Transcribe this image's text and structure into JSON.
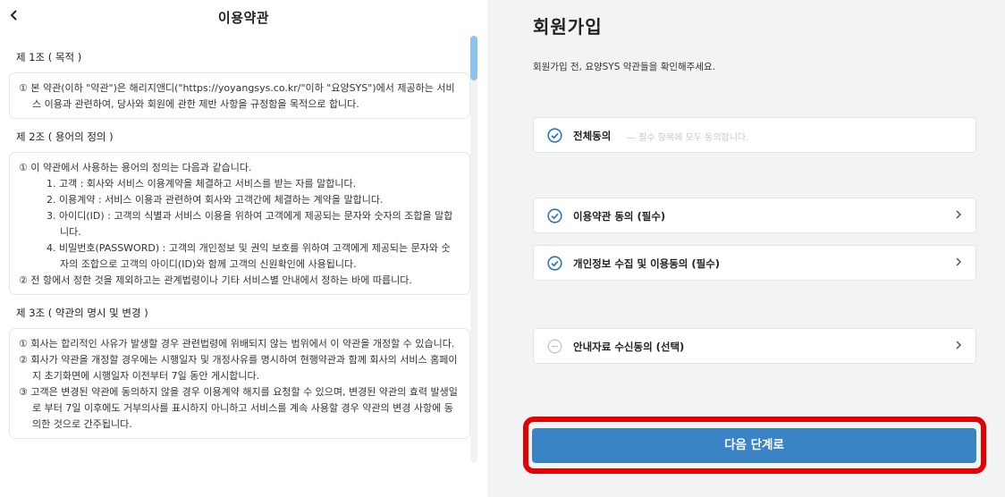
{
  "left_panel": {
    "title": "이용약관",
    "back_icon": "chevron-left-icon",
    "articles": [
      {
        "title": "제 1조 ( 목적 )",
        "paragraphs": [
          "① 본 약관(이하 \"약관\")은 해리지앤디(\"https://yoyangsys.co.kr/\"이하 \"요양SYS\")에서 제공하는 서비스 이용과 관련하여, 당사와 회원에 관한 제반 사항을 규정함을 목적으로 합니다."
        ]
      },
      {
        "title": "제 2조 ( 용어의 정의 )",
        "intro": "① 이 약관에서 사용하는 용어의 정의는 다음과 같습니다.",
        "items": [
          "1.  고객 : 회사와 서비스 이용계약을 체결하고 서비스를 받는 자를 말합니다.",
          "2.  이용계약 : 서비스 이용과 관련하여 회사와 고객간에 체결하는 계약을 말합니다.",
          "3.  아이디(ID) : 고객의 식별과 서비스 이용을 위하여 고객에게 제공되는 문자와 숫자의 조합을 말합니다.",
          "4.  비밀번호(PASSWORD) : 고객의 개인정보 및 권익 보호를 위하여 고객에게 제공되는 문자와 숫자의 조합으로 고객의 아이디(ID)와 함께 고객의 신원확인에 사용됩니다."
        ],
        "outro": "② 전 항에서 정한 것을 제외하고는 관계법령이나 기타 서비스별 안내에서 정하는 바에 따릅니다."
      },
      {
        "title": "제 3조 ( 약관의 명시 및 변경 )",
        "paragraphs": [
          "① 회사는 합리적인 사유가 발생할 경우 관련법령에 위배되지 않는 범위에서 이 약관을 개정할 수 있습니다.",
          "② 회사가 약관을 개정할 경우에는 시행일자 및 개정사유를 명시하여 현행약관과 함께 회사의 서비스 홈페이지 초기화면에 시행일자 이전부터 7일 동안 게시합니다.",
          "③ 고객은 변경된 약관에 동의하지 않을 경우 이용계약 해지를 요청할 수 있으며, 변경된 약관의 효력 발생일로 부터 7일 이후에도 거부의사를 표시하지 아니하고 서비스를 계속 사용할 경우 약관의 변경 사항에 동의한 것으로 간주됩니다."
        ]
      }
    ]
  },
  "right_panel": {
    "title": "회원가입",
    "description": "회원가입 전, 요양SYS 약관들을 확인해주세요.",
    "agree_all": {
      "label": "전체동의",
      "sub": "—  필수 항목에 모두 동의합니다.",
      "checked": true
    },
    "agreements": [
      {
        "label": "이용약관 동의 (필수)",
        "checked": true,
        "required": true
      },
      {
        "label": "개인정보 수집 및 이용동의 (필수)",
        "checked": true,
        "required": true
      },
      {
        "label": "안내자료 수신동의 (선택)",
        "checked": false,
        "required": false
      }
    ],
    "next_button": "다음 단계로"
  },
  "colors": {
    "accent": "#3a84c6",
    "highlight_border": "#e40000",
    "check_active": "#2b74b8",
    "check_inactive": "#c5c8cf",
    "scroll_thumb": "#8fc3ef"
  }
}
